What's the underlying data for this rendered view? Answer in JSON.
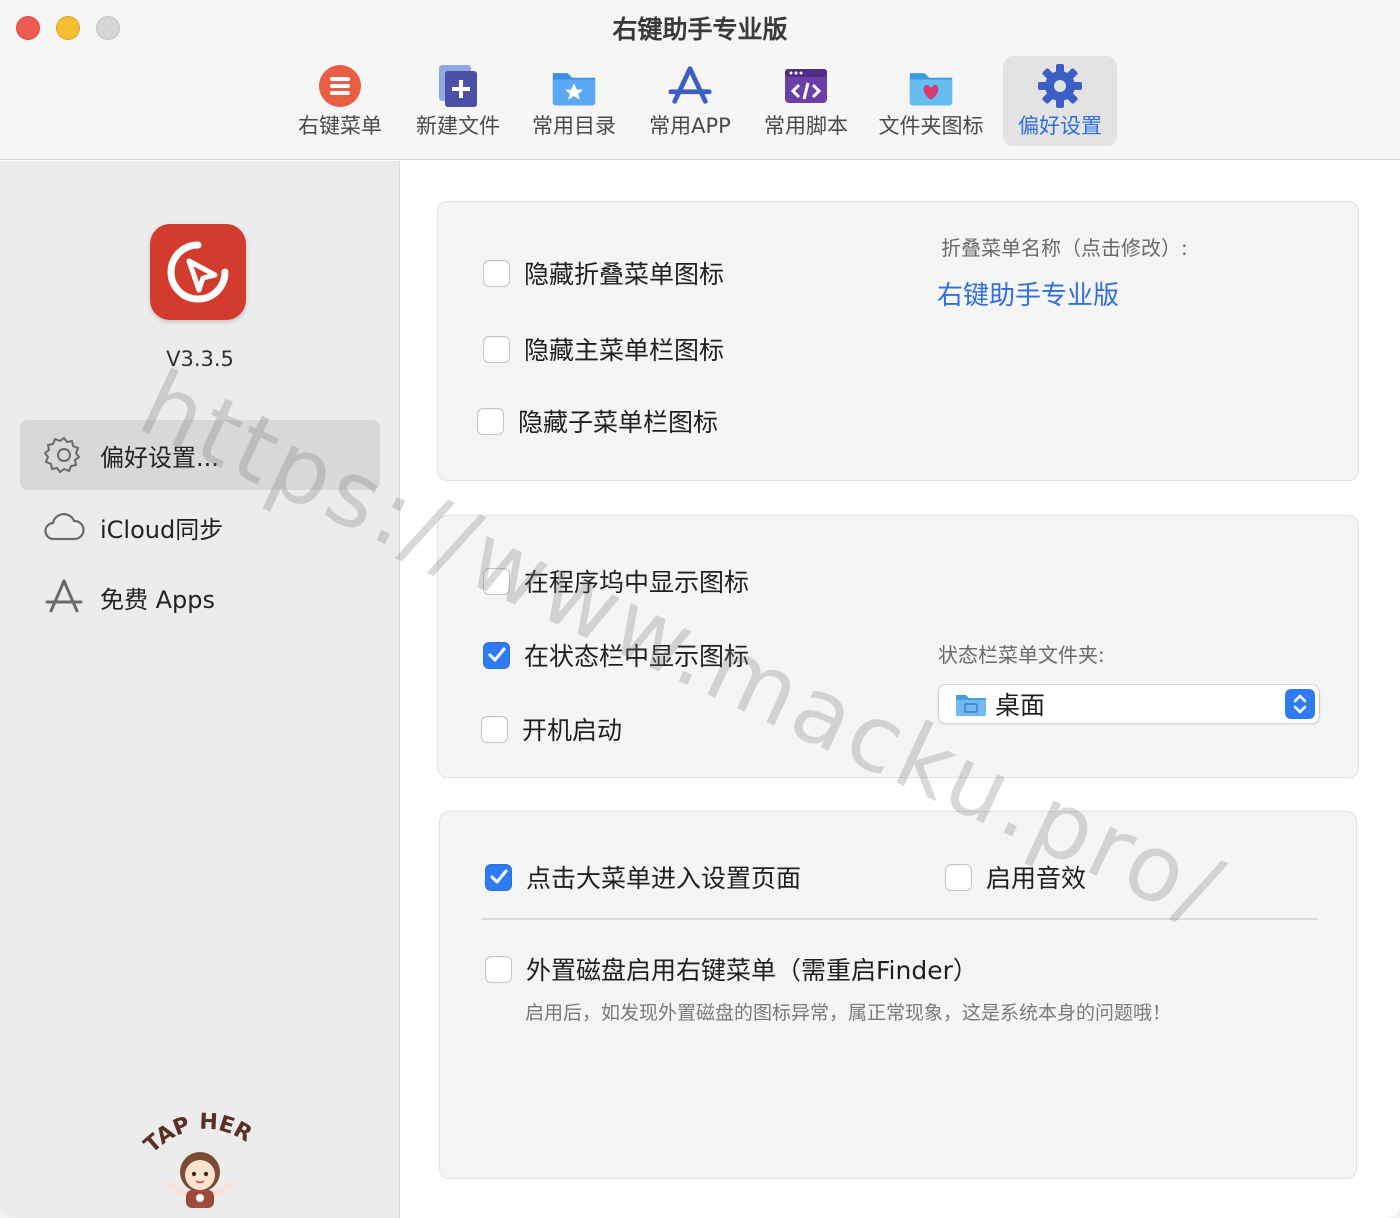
{
  "window": {
    "title": "右键助手专业版",
    "controls": [
      "close",
      "minimize",
      "maximize"
    ]
  },
  "toolbar": {
    "items": [
      {
        "label": "右键菜单",
        "icon": "list-circle-icon",
        "active": false
      },
      {
        "label": "新建文件",
        "icon": "new-file-icon",
        "active": false
      },
      {
        "label": "常用目录",
        "icon": "star-folder-icon",
        "active": false
      },
      {
        "label": "常用APP",
        "icon": "app-store-icon",
        "active": false
      },
      {
        "label": "常用脚本",
        "icon": "script-icon",
        "active": false
      },
      {
        "label": "文件夹图标",
        "icon": "heart-folder-icon",
        "active": false
      },
      {
        "label": "偏好设置",
        "icon": "gear-icon",
        "active": true
      }
    ]
  },
  "sidebar": {
    "version": "V3.3.5",
    "items": [
      {
        "label": "偏好设置...",
        "icon": "gear-icon",
        "active": true
      },
      {
        "label": "iCloud同步",
        "icon": "cloud-icon",
        "active": false
      },
      {
        "label": "免费 Apps",
        "icon": "app-store-icon",
        "active": false
      }
    ],
    "mascot_text": "TAP HERE"
  },
  "panel1": {
    "hide_fold_menu_icon": {
      "label": "隐藏折叠菜单图标",
      "checked": false
    },
    "hide_main_menubar_icon": {
      "label": "隐藏主菜单栏图标",
      "checked": false
    },
    "hide_sub_menubar_icon": {
      "label": "隐藏子菜单栏图标",
      "checked": false
    },
    "fold_menu_name_caption": "折叠菜单名称（点击修改）:",
    "fold_menu_name_value": "右键助手专业版"
  },
  "panel2": {
    "show_in_dock": {
      "label": "在程序坞中显示图标",
      "checked": false
    },
    "show_in_statusbar": {
      "label": "在状态栏中显示图标",
      "checked": true
    },
    "launch_at_login": {
      "label": "开机启动",
      "checked": false
    },
    "statusbar_folder_caption": "状态栏菜单文件夹:",
    "statusbar_folder_value": "桌面"
  },
  "panel3": {
    "click_big_menu": {
      "label": "点击大菜单进入设置页面",
      "checked": true
    },
    "enable_sound": {
      "label": "启用音效",
      "checked": false
    },
    "external_disk_menu": {
      "label": "外置磁盘启用右键菜单（需重启Finder）",
      "checked": false
    },
    "external_disk_hint": "启用后，如发现外置磁盘的图标异常，属正常现象，这是系统本身的问题哦！"
  },
  "watermark": "https://www.macku.pro/",
  "colors": {
    "accent": "#2f7bf5",
    "link": "#2f6fe0",
    "app_logo": "#d23b2e",
    "close": "#ee5b52",
    "minimize": "#f6bd30",
    "maximize": "#d5d5d5"
  }
}
